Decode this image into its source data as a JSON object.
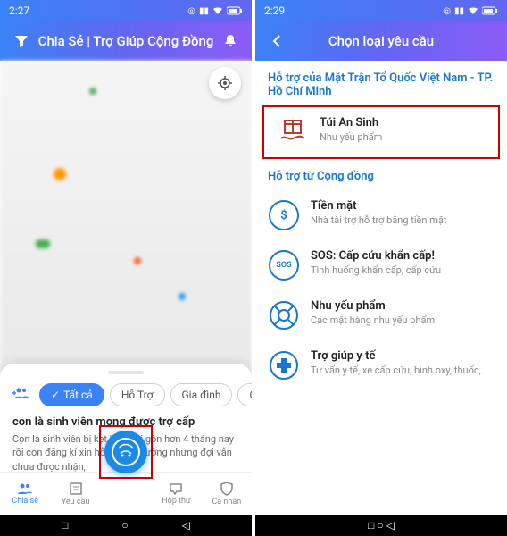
{
  "left": {
    "status_time": "2:27",
    "header_title": "Chia Sẻ | Trợ Giúp Cộng Đồng",
    "chips": [
      "Tất cả",
      "Hỗ Trợ",
      "Gia đình",
      "Cộng"
    ],
    "post": {
      "title": "con là sinh viên mong được trợ cấp",
      "body": "Con là sinh viên bị kẹt lại ở sài gòn hơn 4 tháng nay rồi con đăng kí xin hỗ trợ từ phường nhưng đợi vẫn chưa được nhận,"
    },
    "nav": [
      "Chia sẻ",
      "Yêu cầu",
      "",
      "Hộp thư",
      "Cá nhân"
    ]
  },
  "right": {
    "status_time": "2:29",
    "header_title": "Chọn loại yêu cầu",
    "section1": "Hỗ trợ của Mặt Trận Tổ Quốc Việt Nam - TP. Hồ Chí Minh",
    "opt1": {
      "title": "Túi An Sinh",
      "sub": "Nhu yếu phẩm"
    },
    "section2": "Hỗ trợ từ Cộng đồng",
    "opt2": {
      "title": "Tiền mặt",
      "sub": "Nhà tài trợ hỗ trợ bằng tiền mặt"
    },
    "opt3": {
      "title": "SOS: Cấp cứu khẩn cấp!",
      "sub": "Tình huống khẩn cấp, cấp cứu"
    },
    "opt4": {
      "title": "Nhu yếu phẩm",
      "sub": "Các mặt hàng nhu yếu phẩm"
    },
    "opt5": {
      "title": "Trợ giúp y tế",
      "sub": "Tư vấn y tế, xe cấp cứu, bình oxy, thuốc,."
    }
  }
}
